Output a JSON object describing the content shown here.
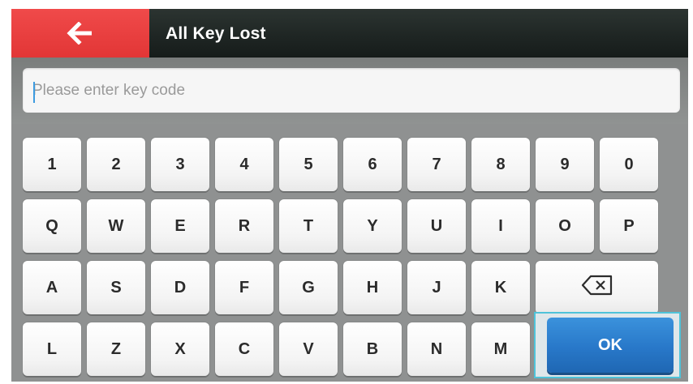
{
  "header": {
    "title": "All Key Lost",
    "back_icon": "arrow-left-icon",
    "back_color": "#e63c3c"
  },
  "input": {
    "placeholder": "Please enter key code",
    "value": ""
  },
  "keyboard": {
    "rows": [
      [
        "1",
        "2",
        "3",
        "4",
        "5",
        "6",
        "7",
        "8",
        "9",
        "0"
      ],
      [
        "Q",
        "W",
        "E",
        "R",
        "T",
        "Y",
        "U",
        "I",
        "O",
        "P"
      ],
      [
        "A",
        "S",
        "D",
        "F",
        "G",
        "H",
        "J",
        "K"
      ],
      [
        "L",
        "Z",
        "X",
        "C",
        "V",
        "B",
        "N",
        "M"
      ]
    ],
    "backspace_icon": "backspace-icon",
    "ok_label": "OK",
    "ok_color": "#2a7cca",
    "focus_color": "#4fc3d9"
  }
}
